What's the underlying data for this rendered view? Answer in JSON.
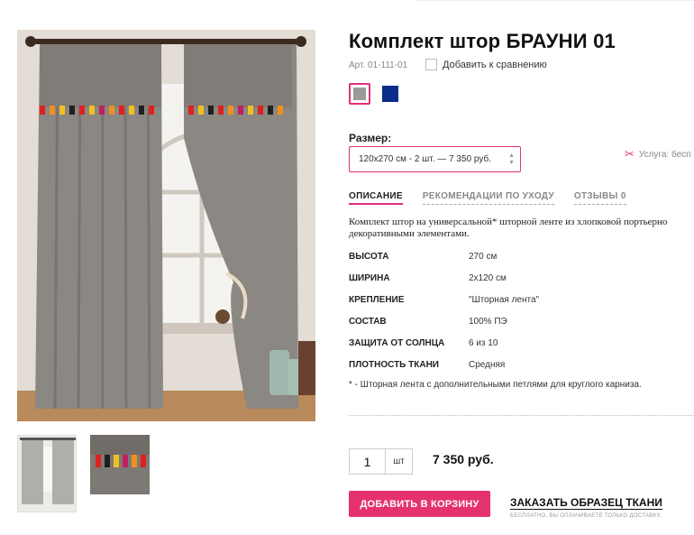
{
  "product": {
    "title": "Комплект штор БРАУНИ 01",
    "sku": "Арт. 01-111-01",
    "compare_label": "Добавить к сравнению",
    "colors": [
      {
        "name": "grey",
        "hex": "#9a9a9a",
        "selected": true
      },
      {
        "name": "blue",
        "hex": "#0a2d8a",
        "selected": false
      }
    ]
  },
  "size": {
    "label": "Размер:",
    "selected": "120x270 см - 2 шт. — 7 350 руб."
  },
  "service": {
    "label": "Услуга: бесп"
  },
  "tabs": [
    {
      "label": "ОПИСАНИЕ",
      "active": true
    },
    {
      "label": "РЕКОМЕНДАЦИИ ПО УХОДУ",
      "active": false
    },
    {
      "label": "ОТЗЫВЫ 0",
      "active": false
    }
  ],
  "description": {
    "line1": "Комплект штор на универсальной* шторной ленте из хлопковой портьерно",
    "line2": "декоративными элементами."
  },
  "specs": [
    {
      "name": "ВЫСОТА",
      "value": "270 см"
    },
    {
      "name": "ШИРИНА",
      "value": "2x120 см"
    },
    {
      "name": "КРЕПЛЕНИЕ",
      "value": "\"Шторная лента\""
    },
    {
      "name": "СОСТАВ",
      "value": "100% ПЭ"
    },
    {
      "name": "ЗАЩИТА ОТ СОЛНЦА",
      "value": "6 из 10"
    },
    {
      "name": "ПЛОТНОСТЬ ТКАНИ",
      "value": "Средняя"
    }
  ],
  "footnote": "* - Шторная лента с дополнительными петлями для круглого карниза.",
  "purchase": {
    "quantity": "1",
    "unit": "шт",
    "price": "7 350 руб.",
    "add_to_cart": "ДОБАВИТЬ В КОРЗИНУ",
    "order_sample": "ЗАКАЗАТЬ ОБРАЗЕЦ ТКАНИ",
    "order_sample_note": "БЕСПЛАТНО, ВЫ ОПЛАЧИВАЕТЕ ТОЛЬКО ДОСТАВКУ."
  },
  "icons": {
    "scissors": "scissors-icon",
    "select_arrows": "chevron-updown-icon"
  }
}
